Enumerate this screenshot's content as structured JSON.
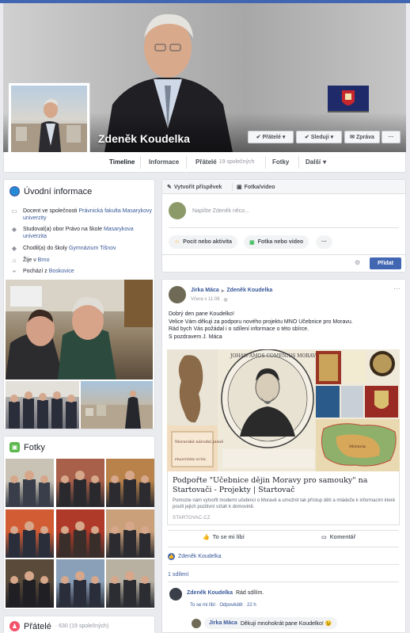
{
  "profile": {
    "name": "Zdeněk Koudelka",
    "buttons": {
      "friends": "Přátelé",
      "following": "Sleduji",
      "message": "Zpráva",
      "more": "···"
    }
  },
  "nav": {
    "timeline": "Timeline",
    "about": "Informace",
    "friends": "Přátelé",
    "friends_count": "19 společných",
    "photos": "Fotky",
    "more": "Další"
  },
  "intro": {
    "title": "Úvodní informace",
    "items": [
      {
        "prefix": "Docent ve společnosti ",
        "link": "Právnická fakulta Masarykovy univerzity"
      },
      {
        "prefix": "Studoval(a) obor Právo na škole ",
        "link": "Masarykova univerzita"
      },
      {
        "prefix": "Chodil(a) do školy ",
        "link": "Gymnázium Tišnov"
      },
      {
        "prefix": "Žije v ",
        "link": "Brno"
      },
      {
        "prefix": "Pochází z ",
        "link": "Boskovice"
      }
    ]
  },
  "photos_card": {
    "title": "Fotky"
  },
  "friends_card": {
    "title": "Přátelé",
    "count": "· 630 (19 společných)"
  },
  "composer": {
    "tab_create": "Vytvořit příspěvek",
    "tab_photo": "Fotka/video",
    "placeholder": "Napište Zdeněk něco...",
    "feeling": "Pocit nebo aktivita",
    "photo_video": "Fotka nebo video",
    "more": "···",
    "submit": "Přidat"
  },
  "post": {
    "author": "Jirka Máca",
    "arrow": "▸",
    "target": "Zdeněk Koudelka",
    "time": "Včera v 11:08",
    "menu": "···",
    "text": [
      "Dobrý den pane Koudelko!",
      "Velice Vám děkuji za podporu nového projektu MNO Učebnice pro Moravu.",
      "Rád bych Vás požádal i o sdílení informace o této sbírce.",
      "S pozdravem J. Máca"
    ],
    "image_caption_top": "JOHAN·AMOS COMENIUS MORAVUS A'XVII",
    "image_card_text": "Moravské národní písně",
    "image_card_name": "FRANTIŠEK SUŠIL",
    "image_map_title": "Moravia",
    "link_title": "Podpořte \"Učebnice dějin Moravy pro samouky\" na Startovači - Projekty | Startovač",
    "link_desc": "Pomozte nám vytvořit moderní učebnici o Moravě a umožnit tak přístup dětí a mládeže k informacím které posílí jejich pozitivní vztah k domovině.",
    "link_domain": "STARTOVAC.CZ",
    "like": "To se mi líbí",
    "comment": "Komentář",
    "reaction_name": "Zdeněk Koudelka",
    "shares": "1 sdílení",
    "comments": [
      {
        "author": "Zdeněk Koudelka",
        "text": "Rád sdílím.",
        "actions": "To se mi líbí · Odpovědět · 22 h"
      },
      {
        "author": "Jirka Máca",
        "text": "Děkuji mnohokrát pane Koudelko! 😉"
      }
    ]
  },
  "colors": {
    "accent": "#4267b2",
    "link": "#385898",
    "background": "#e9ebee"
  }
}
